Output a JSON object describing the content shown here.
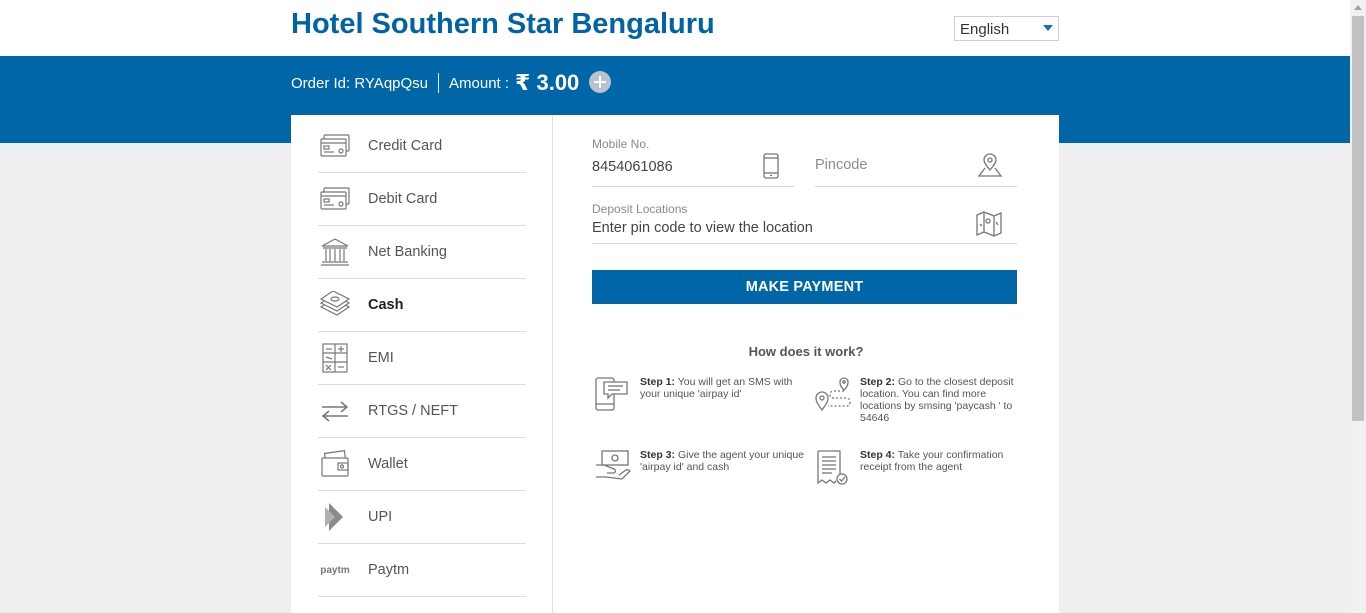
{
  "header": {
    "title": "Hotel Southern Star Bengaluru",
    "language": "English"
  },
  "order": {
    "order_label": "Order Id: RYAqpQsu",
    "amount_label": "Amount :",
    "amount_value": "₹ 3.00"
  },
  "sidebar": {
    "items": [
      {
        "label": "Credit Card",
        "icon": "credit-card-icon"
      },
      {
        "label": "Debit Card",
        "icon": "debit-card-icon"
      },
      {
        "label": "Net Banking",
        "icon": "bank-icon"
      },
      {
        "label": "Cash",
        "icon": "cash-icon"
      },
      {
        "label": "EMI",
        "icon": "calculator-icon"
      },
      {
        "label": "RTGS / NEFT",
        "icon": "transfer-arrows-icon"
      },
      {
        "label": "Wallet",
        "icon": "wallet-icon"
      },
      {
        "label": "UPI",
        "icon": "upi-icon"
      },
      {
        "label": "Paytm",
        "icon": "paytm-icon"
      }
    ],
    "active": "Cash",
    "paytm_logo_text": "paytm"
  },
  "form": {
    "mobile_label": "Mobile No.",
    "mobile_value": "8454061086",
    "pincode_placeholder": "Pincode",
    "deposit_label": "Deposit Locations",
    "deposit_placeholder": "Enter pin code to view the location",
    "make_payment": "MAKE PAYMENT"
  },
  "how": {
    "title": "How does it work?",
    "steps": [
      {
        "head": "Step 1:",
        "text": "You will get an SMS with your unique 'airpay id'"
      },
      {
        "head": "Step 2:",
        "text": "Go to the closest deposit location. You can find more locations by smsing 'paycash ' to 54646"
      },
      {
        "head": "Step 3:",
        "text": "Give the agent your unique 'airpay id' and cash"
      },
      {
        "head": "Step 4:",
        "text": "Take your confirmation receipt from the agent"
      }
    ]
  },
  "colors": {
    "brand_blue": "#0066a8",
    "title_blue": "#0063a6",
    "page_bg": "#efefef"
  }
}
